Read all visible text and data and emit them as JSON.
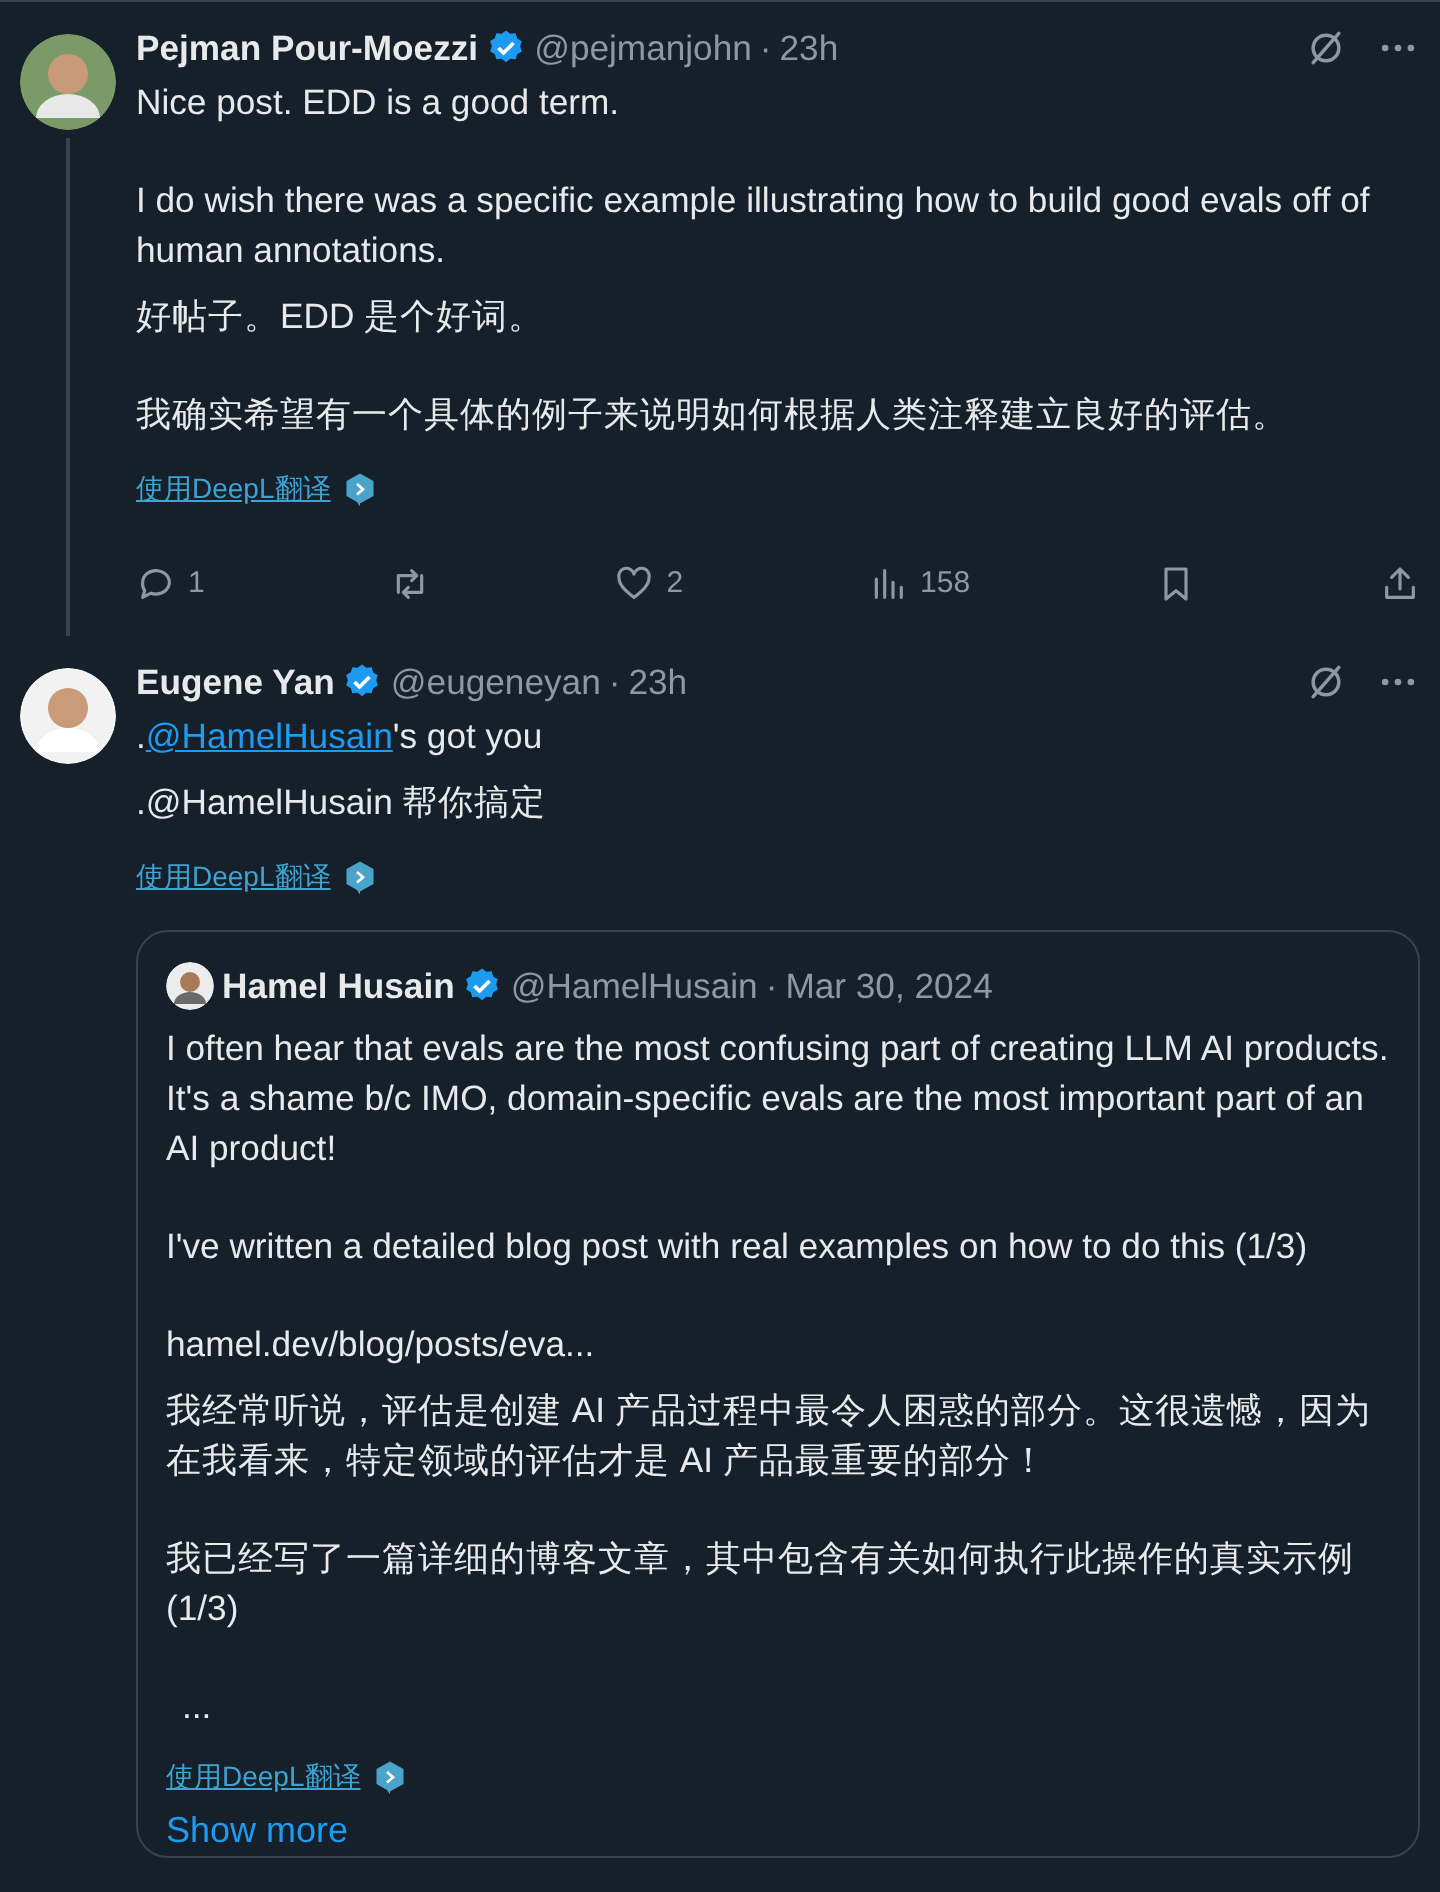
{
  "tweets": [
    {
      "author": "Pejman Pour-Moezzi",
      "verified": true,
      "handle": "@pejmanjohn",
      "separator": "·",
      "time": "23h",
      "thread_line": true,
      "paragraphs": [
        "Nice post. EDD is a good term.",
        "I do wish there was a specific example illustrating how to build good evals off of human annotations."
      ],
      "translation": [
        "好帖子。EDD 是个好词。",
        "我确实希望有一个具体的例子来说明如何根据人类注释建立良好的评估。"
      ],
      "translate_link": "使用DeepL翻译",
      "actions": [
        {
          "kind": "reply",
          "count": "1"
        },
        {
          "kind": "repost"
        },
        {
          "kind": "like",
          "count": "2"
        },
        {
          "kind": "views",
          "count": "158"
        },
        {
          "kind": "bookmark"
        },
        {
          "kind": "share"
        }
      ]
    },
    {
      "author": "Eugene Yan",
      "verified": true,
      "handle": "@eugeneyan",
      "separator": "·",
      "time": "23h",
      "thread_line": false,
      "paragraphs": [
        [
          {
            "text": "."
          },
          {
            "text": "@HamelHusain",
            "kind": "mention"
          },
          {
            "text": "'s got you"
          }
        ]
      ],
      "translation": [
        ".@HamelHusain 帮你搞定"
      ],
      "translate_link": "使用DeepL翻译",
      "quote": {
        "author": "Hamel Husain",
        "verified": true,
        "handle": "@HamelHusain",
        "separator": "·",
        "date": "Mar 30, 2024",
        "paragraphs": [
          "I often hear that evals are the most confusing part of creating LLM AI products.  It's a shame b/c IMO, domain-specific evals are the most important part of an AI product!",
          "I've written a detailed blog post with real examples on how to do this (1/3)",
          "hamel.dev/blog/posts/eva..."
        ],
        "translation": [
          "我经常听说，评估是创建 AI 产品过程中最令人困惑的部分。这很遗憾，因为在我看来，特定领域的评估才是 AI 产品最重要的部分！",
          "我已经写了一篇详细的博客文章，其中包含有关如何执行此操作的真实示例 (1/3)",
          "..."
        ],
        "translate_link": "使用DeepL翻译",
        "show_more": "Show more"
      }
    }
  ]
}
